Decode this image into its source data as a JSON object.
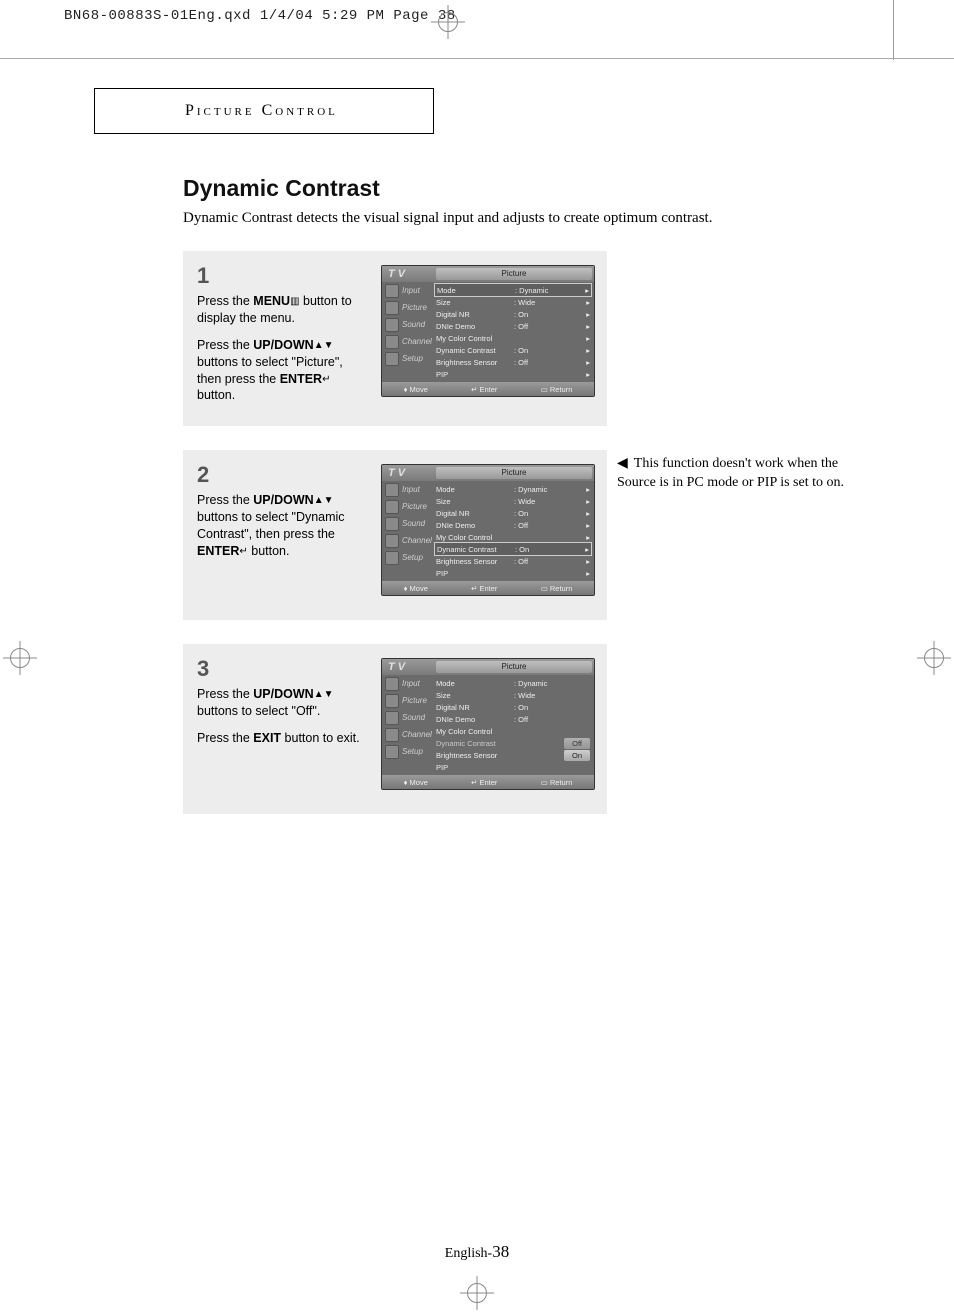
{
  "runhead": "BN68-00883S-01Eng.qxd  1/4/04 5:29 PM  Page 38",
  "section_title": "Picture Control",
  "page_title": "Dynamic Contrast",
  "intro": "Dynamic Contrast detects the visual signal input and adjusts to create optimum contrast.",
  "note_arrow": "◀",
  "side_note": "This function doesn't work when the Source is in PC mode or PIP is set to on.",
  "page_footer_prefix": "English-",
  "page_footer_num": "38",
  "glyphs": {
    "menu": "▥",
    "updown": "▲▼",
    "enter": "↵",
    "move": "♦",
    "return": "▭",
    "tri": "▸"
  },
  "osd_common": {
    "tv_label": "T V",
    "title": "Picture",
    "side": [
      "Input",
      "Picture",
      "Sound",
      "Channel",
      "Setup"
    ],
    "footer": {
      "move": "Move",
      "enter": "Enter",
      "return": "Return"
    }
  },
  "steps": [
    {
      "num": "1",
      "paras": [
        "Press the <b>MENU</b><span class='icon-glyph'>▥</span> button to display the menu.",
        "Press the <b>UP/DOWN</b><span class='icon-glyph'>▲▼</span> buttons to select \"Picture\", then press the <b>ENTER</b><span class='icon-glyph'>↵</span> button."
      ],
      "osd_rows": [
        {
          "k": "Mode",
          "v": ": Dynamic",
          "arr": true,
          "boxed": true
        },
        {
          "k": "Size",
          "v": ": Wide",
          "arr": true
        },
        {
          "k": "Digital NR",
          "v": ": On",
          "arr": true
        },
        {
          "k": "DNIe Demo",
          "v": ": Off",
          "arr": true
        },
        {
          "k": "My Color Control",
          "v": "",
          "arr": true
        },
        {
          "k": "Dynamic Contrast",
          "v": ": On",
          "arr": true
        },
        {
          "k": "Brightness Sensor",
          "v": ": Off",
          "arr": true
        },
        {
          "k": "PIP",
          "v": "",
          "arr": true
        }
      ]
    },
    {
      "num": "2",
      "paras": [
        "Press the <b>UP/DOWN</b><span class='icon-glyph'>▲▼</span> buttons to select \"Dynamic Contrast\", then press the <b>ENTER</b><span class='icon-glyph'>↵</span> button."
      ],
      "osd_rows": [
        {
          "k": "Mode",
          "v": ": Dynamic",
          "arr": true
        },
        {
          "k": "Size",
          "v": ": Wide",
          "arr": true
        },
        {
          "k": "Digital NR",
          "v": ": On",
          "arr": true
        },
        {
          "k": "DNIe Demo",
          "v": ": Off",
          "arr": true
        },
        {
          "k": "My Color Control",
          "v": "",
          "arr": true
        },
        {
          "k": "Dynamic Contrast",
          "v": ": On",
          "arr": true,
          "boxed": true
        },
        {
          "k": "Brightness Sensor",
          "v": ": Off",
          "arr": true
        },
        {
          "k": "PIP",
          "v": "",
          "arr": true
        }
      ]
    },
    {
      "num": "3",
      "paras": [
        "Press the <b>UP/DOWN</b><span class='icon-glyph'>▲▼</span> buttons to select \"Off\".",
        "Press the <b>EXIT</b> button to exit."
      ],
      "osd_rows": [
        {
          "k": "Mode",
          "v": ": Dynamic"
        },
        {
          "k": "Size",
          "v": ": Wide"
        },
        {
          "k": "Digital NR",
          "v": ": On"
        },
        {
          "k": "DNIe Demo",
          "v": ": Off"
        },
        {
          "k": "My Color Control",
          "v": ""
        },
        {
          "k": "Dynamic Contrast",
          "v": "",
          "opt": "Off",
          "dim": true
        },
        {
          "k": "Brightness Sensor",
          "v": "",
          "opt": "On"
        },
        {
          "k": "PIP",
          "v": ""
        }
      ]
    }
  ]
}
